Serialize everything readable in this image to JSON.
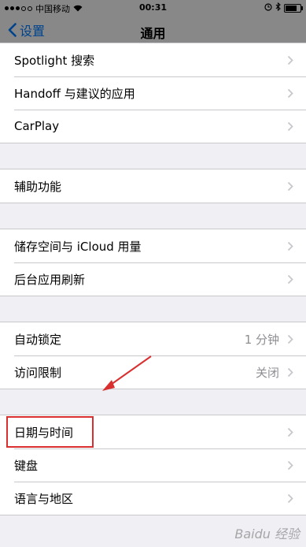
{
  "status_bar": {
    "carrier": "中国移动",
    "time": "00:31"
  },
  "nav": {
    "back_label": "设置",
    "title": "通用"
  },
  "groups": [
    {
      "items": [
        {
          "label": "Spotlight 搜索",
          "value": ""
        },
        {
          "label": "Handoff 与建议的应用",
          "value": ""
        },
        {
          "label": "CarPlay",
          "value": ""
        }
      ]
    },
    {
      "items": [
        {
          "label": "辅助功能",
          "value": ""
        }
      ]
    },
    {
      "items": [
        {
          "label": "储存空间与 iCloud 用量",
          "value": ""
        },
        {
          "label": "后台应用刷新",
          "value": ""
        }
      ]
    },
    {
      "items": [
        {
          "label": "自动锁定",
          "value": "1 分钟"
        },
        {
          "label": "访问限制",
          "value": "关闭"
        }
      ]
    },
    {
      "items": [
        {
          "label": "日期与时间",
          "value": ""
        },
        {
          "label": "键盘",
          "value": ""
        },
        {
          "label": "语言与地区",
          "value": ""
        }
      ]
    }
  ],
  "annotation": {
    "highlighted_item": "日期与时间",
    "color": "#d9302f"
  },
  "watermark": "Baidu 经验",
  "colors": {
    "accent": "#007aff",
    "background": "#efeff4",
    "separator": "#c8c7cc",
    "secondary_text": "#8e8e93"
  }
}
